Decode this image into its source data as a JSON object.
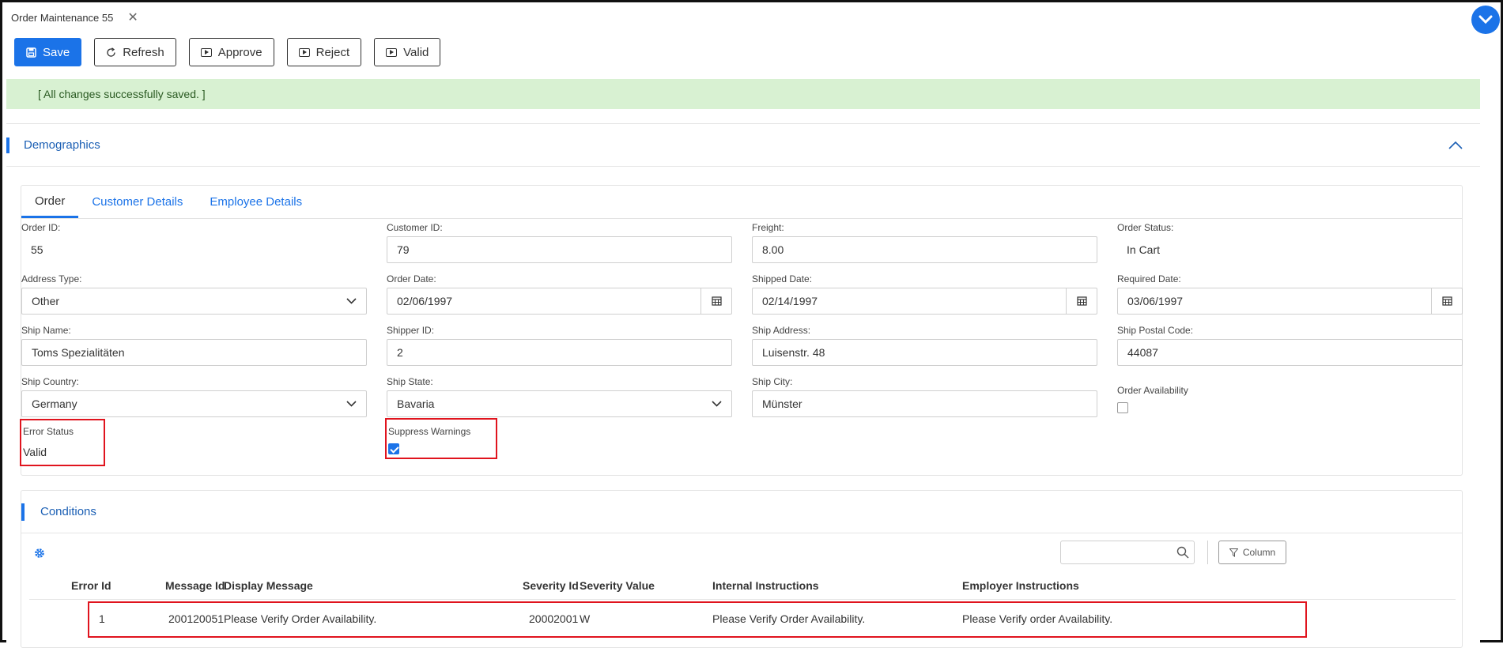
{
  "window": {
    "tab_title": "Order Maintenance 55",
    "close_glyph": "✕"
  },
  "toolbar": {
    "save": "Save",
    "refresh": "Refresh",
    "approve": "Approve",
    "reject": "Reject",
    "valid": "Valid"
  },
  "alert": {
    "message": "[ All changes successfully saved. ]"
  },
  "section": {
    "title": "Demographics"
  },
  "tabs": [
    "Order",
    "Customer Details",
    "Employee Details"
  ],
  "form": {
    "order_id": {
      "label": "Order ID:",
      "value": "55"
    },
    "customer_id": {
      "label": "Customer ID:",
      "value": "79"
    },
    "freight": {
      "label": "Freight:",
      "value": "8.00"
    },
    "order_status": {
      "label": "Order Status:",
      "value": "In Cart"
    },
    "address_type": {
      "label": "Address Type:",
      "value": "Other"
    },
    "order_date": {
      "label": "Order Date:",
      "value": "02/06/1997"
    },
    "shipped_date": {
      "label": "Shipped Date:",
      "value": "02/14/1997"
    },
    "required_date": {
      "label": "Required Date:",
      "value": "03/06/1997"
    },
    "ship_name": {
      "label": "Ship Name:",
      "value": "Toms Spezialitäten"
    },
    "shipper_id": {
      "label": "Shipper ID:",
      "value": "2"
    },
    "ship_address": {
      "label": "Ship Address:",
      "value": "Luisenstr. 48"
    },
    "ship_postal_code": {
      "label": "Ship Postal Code:",
      "value": "44087"
    },
    "ship_country": {
      "label": "Ship Country:",
      "value": "Germany"
    },
    "ship_state": {
      "label": "Ship State:",
      "value": "Bavaria"
    },
    "ship_city": {
      "label": "Ship City:",
      "value": "Münster"
    },
    "order_availability": {
      "label": "Order Availability",
      "checked": false
    },
    "error_status": {
      "label": "Error Status",
      "value": "Valid"
    },
    "suppress_warnings": {
      "label": "Suppress Warnings",
      "checked": true
    }
  },
  "conditions": {
    "title": "Conditions",
    "column_button": "Column",
    "columns": [
      "Error Id",
      "Message Id",
      "Display Message",
      "Severity Id",
      "Severity Value",
      "Internal Instructions",
      "Employer Instructions"
    ],
    "rows": [
      {
        "error_id": "1",
        "message_id": "200120051",
        "display_message": "Please Verify Order Availability.",
        "severity_id": "20002001",
        "severity_value": "W",
        "internal_instructions": "Please Verify Order Availability.",
        "employer_instructions": "Please Verify order Availability."
      }
    ]
  },
  "colors": {
    "accent": "#1b73e8",
    "alert_bg": "#d8f1d2",
    "highlight": "#e0141e"
  }
}
